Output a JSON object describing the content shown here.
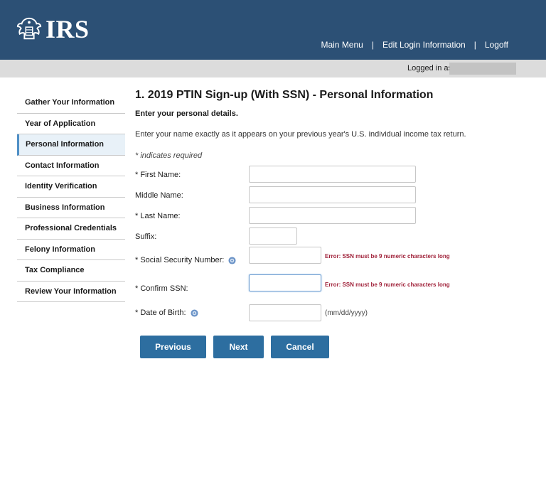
{
  "header": {
    "logo_text": "IRS",
    "nav": [
      {
        "label": "Main Menu"
      },
      {
        "label": "Edit Login Information"
      },
      {
        "label": "Logoff"
      }
    ],
    "separator": "|",
    "bg_color": "#2c5075"
  },
  "login_bar": {
    "label": "Logged in as"
  },
  "sidebar": {
    "items": [
      {
        "label": "Gather Your Information",
        "active": false
      },
      {
        "label": "Year of Application",
        "active": false
      },
      {
        "label": "Personal Information",
        "active": true
      },
      {
        "label": "Contact Information",
        "active": false
      },
      {
        "label": "Identity Verification",
        "active": false
      },
      {
        "label": "Business Information",
        "active": false
      },
      {
        "label": "Professional Credentials",
        "active": false
      },
      {
        "label": "Felony Information",
        "active": false
      },
      {
        "label": "Tax Compliance",
        "active": false
      },
      {
        "label": "Review Your Information",
        "active": false
      }
    ]
  },
  "main": {
    "title": "1. 2019 PTIN Sign-up (With SSN) - Personal Information",
    "subtitle": "Enter your personal details.",
    "instructions": "Enter your name exactly as it appears on your previous year's U.S. individual income tax return.",
    "required_note": "* indicates required",
    "fields": {
      "first_name": {
        "label": "* First Name:",
        "value": ""
      },
      "middle_name": {
        "label": "Middle Name:",
        "value": ""
      },
      "last_name": {
        "label": "* Last Name:",
        "value": ""
      },
      "suffix": {
        "label": "Suffix:",
        "value": ""
      },
      "ssn": {
        "label": "* Social Security Number:",
        "value": "",
        "error": "Error: SSN must be 9 numeric characters long"
      },
      "confirm_ssn": {
        "label": "* Confirm SSN:",
        "value": "",
        "error": "Error: SSN must be 9 numeric characters long"
      },
      "dob": {
        "label": "* Date of Birth:",
        "value": "",
        "hint": "(mm/dd/yyyy)"
      }
    },
    "buttons": {
      "previous": "Previous",
      "next": "Next",
      "cancel": "Cancel"
    },
    "icons": {
      "help": "help-icon",
      "logo": "irs-eagle-logo-icon"
    },
    "colors": {
      "accent": "#2d6ea0",
      "error": "#a0223a",
      "active_bg": "#e8f1f8"
    }
  }
}
